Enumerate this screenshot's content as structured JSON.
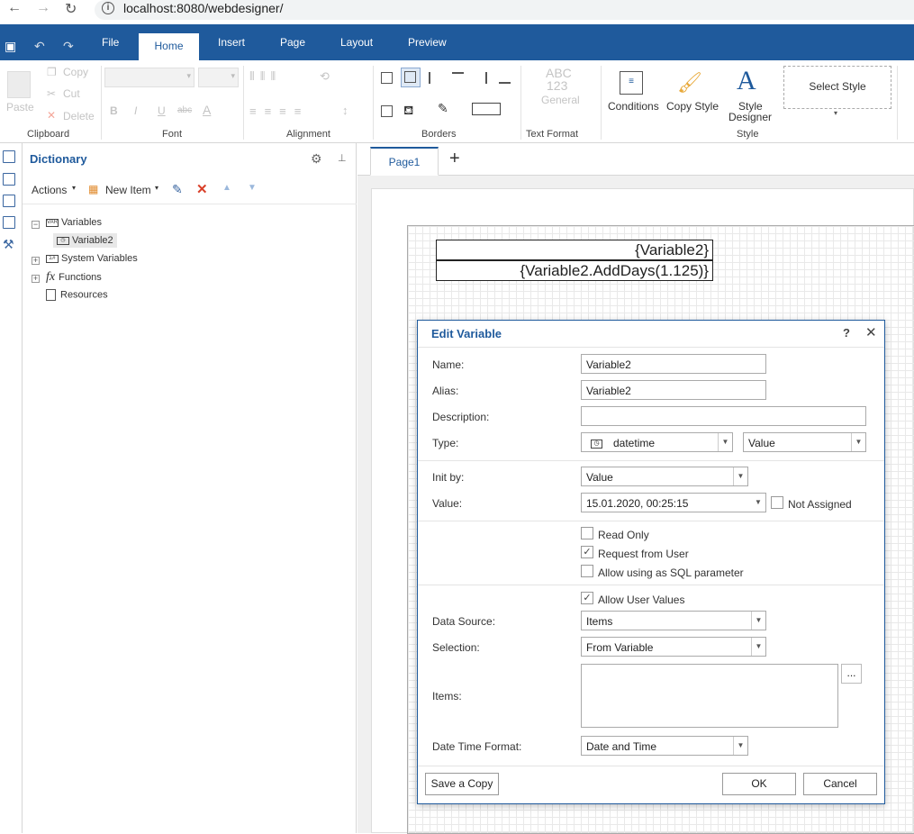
{
  "browser": {
    "url": "localhost:8080/webdesigner/"
  },
  "tabs": [
    "File",
    "Home",
    "Insert",
    "Page",
    "Layout",
    "Preview"
  ],
  "ribbon": {
    "clipboard": {
      "label": "Clipboard",
      "paste": "Paste",
      "copy": "Copy",
      "cut": "Cut",
      "delete": "Delete"
    },
    "font": {
      "label": "Font",
      "bold": "B",
      "italic": "I",
      "underline": "U",
      "strike": "abc",
      "color": "A"
    },
    "alignment": {
      "label": "Alignment"
    },
    "borders": {
      "label": "Borders"
    },
    "text_format": {
      "label": "Text Format",
      "preview_top": "ABC",
      "preview_mid": "123",
      "preview_name": "General"
    },
    "style": {
      "label": "Style",
      "conditions": "Conditions",
      "copy_style": "Copy Style",
      "style_designer_1": "Style",
      "style_designer_2": "Designer",
      "select_style": "Select Style"
    }
  },
  "dictionary": {
    "title": "Dictionary",
    "actions": "Actions",
    "new_item": "New Item",
    "tree": {
      "variables": "Variables",
      "variable2": "Variable2",
      "system_variables": "System Variables",
      "functions": "Functions",
      "resources": "Resources"
    }
  },
  "designer": {
    "page_tab": "Page1",
    "text1": "{Variable2}",
    "text2": "{Variable2.AddDays(1.125)}"
  },
  "dialog": {
    "title": "Edit Variable",
    "help": "?",
    "close": "✕",
    "name_label": "Name:",
    "name_value": "Variable2",
    "alias_label": "Alias:",
    "alias_value": "Variable2",
    "description_label": "Description:",
    "description_value": "",
    "type_label": "Type:",
    "type_value": "datetime",
    "type_kind": "Value",
    "initby_label": "Init by:",
    "initby_value": "Value",
    "value_label": "Value:",
    "value_value": "15.01.2020, 00:25:15",
    "not_assigned": "Not Assigned",
    "read_only": "Read Only",
    "request_from_user": "Request from User",
    "allow_sql": "Allow using as SQL parameter",
    "allow_user_values": "Allow User Values",
    "datasource_label": "Data Source:",
    "datasource_value": "Items",
    "selection_label": "Selection:",
    "selection_value": "From Variable",
    "items_label": "Items:",
    "items_button": "...",
    "datetime_format_label": "Date Time Format:",
    "datetime_format_value": "Date and Time",
    "save_copy": "Save a Copy",
    "ok": "OK",
    "cancel": "Cancel"
  },
  "checks": {
    "not_assigned": false,
    "read_only": false,
    "request_from_user": true,
    "allow_sql": false,
    "allow_user_values": true
  }
}
